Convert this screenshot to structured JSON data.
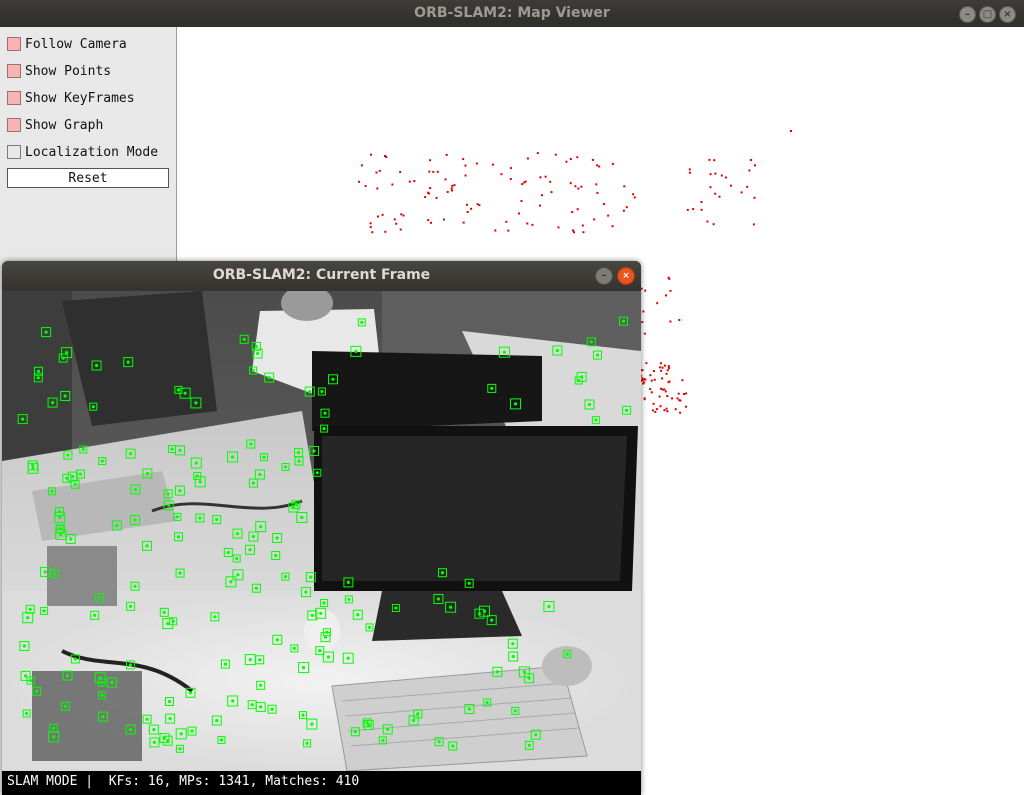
{
  "window": {
    "title": "ORB-SLAM2: Map Viewer",
    "buttons": [
      "minimize",
      "maximize",
      "close"
    ]
  },
  "panel": {
    "checkboxes": [
      {
        "label": "Follow Camera",
        "checked": true
      },
      {
        "label": "Show Points",
        "checked": true
      },
      {
        "label": "Show KeyFrames",
        "checked": true
      },
      {
        "label": "Show Graph",
        "checked": true
      },
      {
        "label": "Localization Mode",
        "checked": false
      }
    ],
    "reset_label": "Reset"
  },
  "frame_window": {
    "title": "ORB-SLAM2: Current Frame",
    "status": "SLAM MODE |  KFs: 16, MPs: 1341, Matches: 410"
  },
  "colors": {
    "map_point": "#e00000",
    "feature": "#00ff00",
    "checkbox_on": "#f7b4b4"
  }
}
